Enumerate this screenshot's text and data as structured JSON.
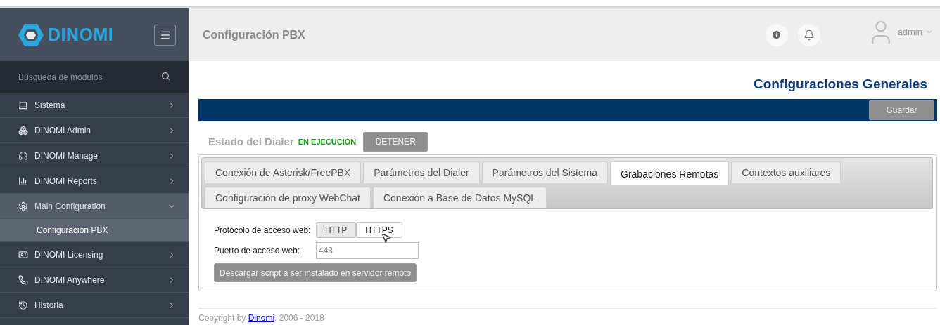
{
  "sidebar": {
    "logo": "DINOMI",
    "search": {
      "placeholder": "Búsqueda de módulos"
    },
    "items": [
      {
        "label": "Sistema",
        "expanded": false
      },
      {
        "label": "DINOMI Admin",
        "expanded": false
      },
      {
        "label": "DINOMI Manage",
        "expanded": false
      },
      {
        "label": "DINOMI Reports",
        "expanded": false
      },
      {
        "label": "Main Configuration",
        "expanded": true,
        "children": [
          {
            "label": "Configuración PBX",
            "selected": true
          }
        ]
      },
      {
        "label": "DINOMI Licensing",
        "expanded": false
      },
      {
        "label": "DINOMI Anywhere",
        "expanded": false
      },
      {
        "label": "Historia",
        "expanded": false
      }
    ]
  },
  "header": {
    "title": "Configuración PBX",
    "user": "admin"
  },
  "section_title": "Configuraciones Generales",
  "save_button": "Guardar",
  "dialer": {
    "label": "Estado del Dialer",
    "status": "EN EJECUCIÓN",
    "button": "DETENER"
  },
  "tabs": [
    {
      "label": "Conexión de Asterisk/FreePBX",
      "selected": false
    },
    {
      "label": "Parámetros del Dialer",
      "selected": false
    },
    {
      "label": "Parámetros del Sistema",
      "selected": false
    },
    {
      "label": "Grabaciones Remotas",
      "selected": true
    },
    {
      "label": "Contextos auxiliares",
      "selected": false
    },
    {
      "label": "Configuración de proxy WebChat",
      "selected": false
    },
    {
      "label": "Conexión a Base de Datos MySQL",
      "selected": false
    }
  ],
  "form": {
    "protocol_label": "Protocolo de acceso web:",
    "protocols": [
      {
        "label": "HTTP",
        "selected": false
      },
      {
        "label": "HTTPS",
        "selected": true
      }
    ],
    "port_label": "Puerto de acceso web:",
    "port_value": "443",
    "download_button": "Descargar script a ser instalado en servidor remoto"
  },
  "footer": {
    "prefix": "Copyright by ",
    "link": "Dinomi",
    "suffix": ", 2006 - 2018"
  }
}
